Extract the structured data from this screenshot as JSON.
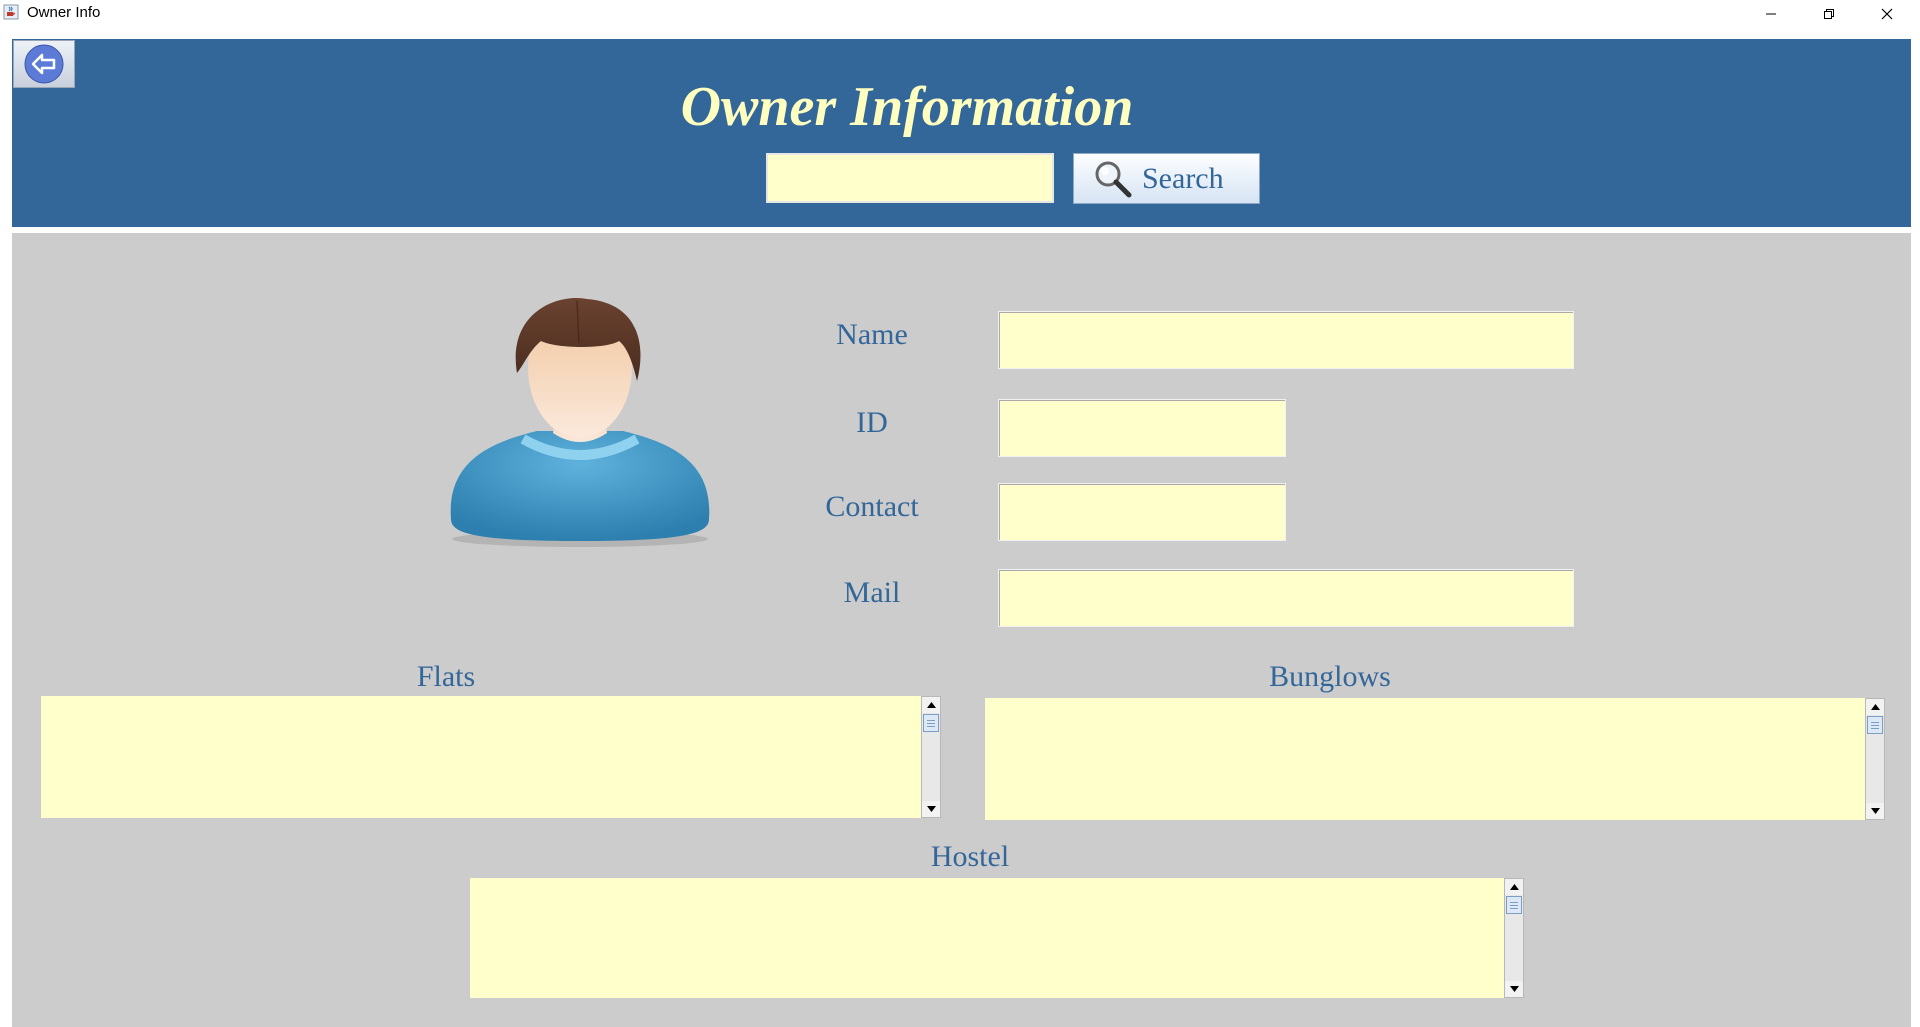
{
  "window": {
    "title": "Owner Info",
    "app_icon": "java-cup-icon",
    "controls": [
      "minimize-icon",
      "restore-icon",
      "close-icon"
    ]
  },
  "header": {
    "title": "Owner Information",
    "back_icon": "back-arrow-icon",
    "search": {
      "value": "",
      "placeholder": "",
      "button_label": "Search",
      "button_icon": "magnifier-icon"
    },
    "background_color": "#336699",
    "title_color": "#ffffc0"
  },
  "profile": {
    "avatar": "user-avatar-icon",
    "fields": {
      "name": {
        "label": "Name",
        "value": ""
      },
      "id": {
        "label": "ID",
        "value": ""
      },
      "contact": {
        "label": "Contact",
        "value": ""
      },
      "mail": {
        "label": "Mail",
        "value": ""
      }
    }
  },
  "sections": {
    "flats": {
      "label": "Flats",
      "content": ""
    },
    "bunglows": {
      "label": "Bunglows",
      "content": ""
    },
    "hostel": {
      "label": "Hostel",
      "content": ""
    }
  },
  "colors": {
    "field_bg": "#ffffcc",
    "panel_bg": "#cccccc",
    "label_color": "#336699"
  }
}
